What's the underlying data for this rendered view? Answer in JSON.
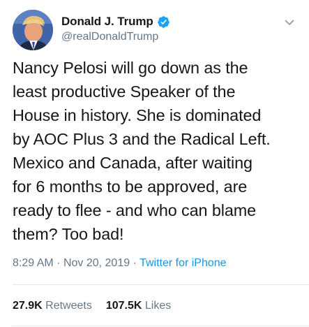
{
  "author": {
    "display_name": "Donald J. Trump",
    "handle": "@realDonaldTrump",
    "verified": true,
    "avatar_icon": "profile-photo"
  },
  "tweet": {
    "lines": [
      "Nancy Pelosi will go down as the",
      "least productive Speaker of the",
      "House in history. She is dominated",
      "by AOC Plus 3 and the Radical Left.",
      "Mexico and Canada, after waiting",
      "for 6 months to be approved, are",
      "ready to flee - and who can blame",
      "them? Too bad!"
    ]
  },
  "meta": {
    "time": "8:29 AM",
    "separator": "·",
    "date": "Nov 20, 2019",
    "source": "Twitter for iPhone"
  },
  "stats": {
    "retweets_count": "27.9K",
    "retweets_label": "Retweets",
    "likes_count": "107.5K",
    "likes_label": "Likes"
  },
  "colors": {
    "accent": "#1b95e0",
    "verified": "#1da1f2",
    "secondary_text": "#657786",
    "divider": "#e1e8ed"
  }
}
